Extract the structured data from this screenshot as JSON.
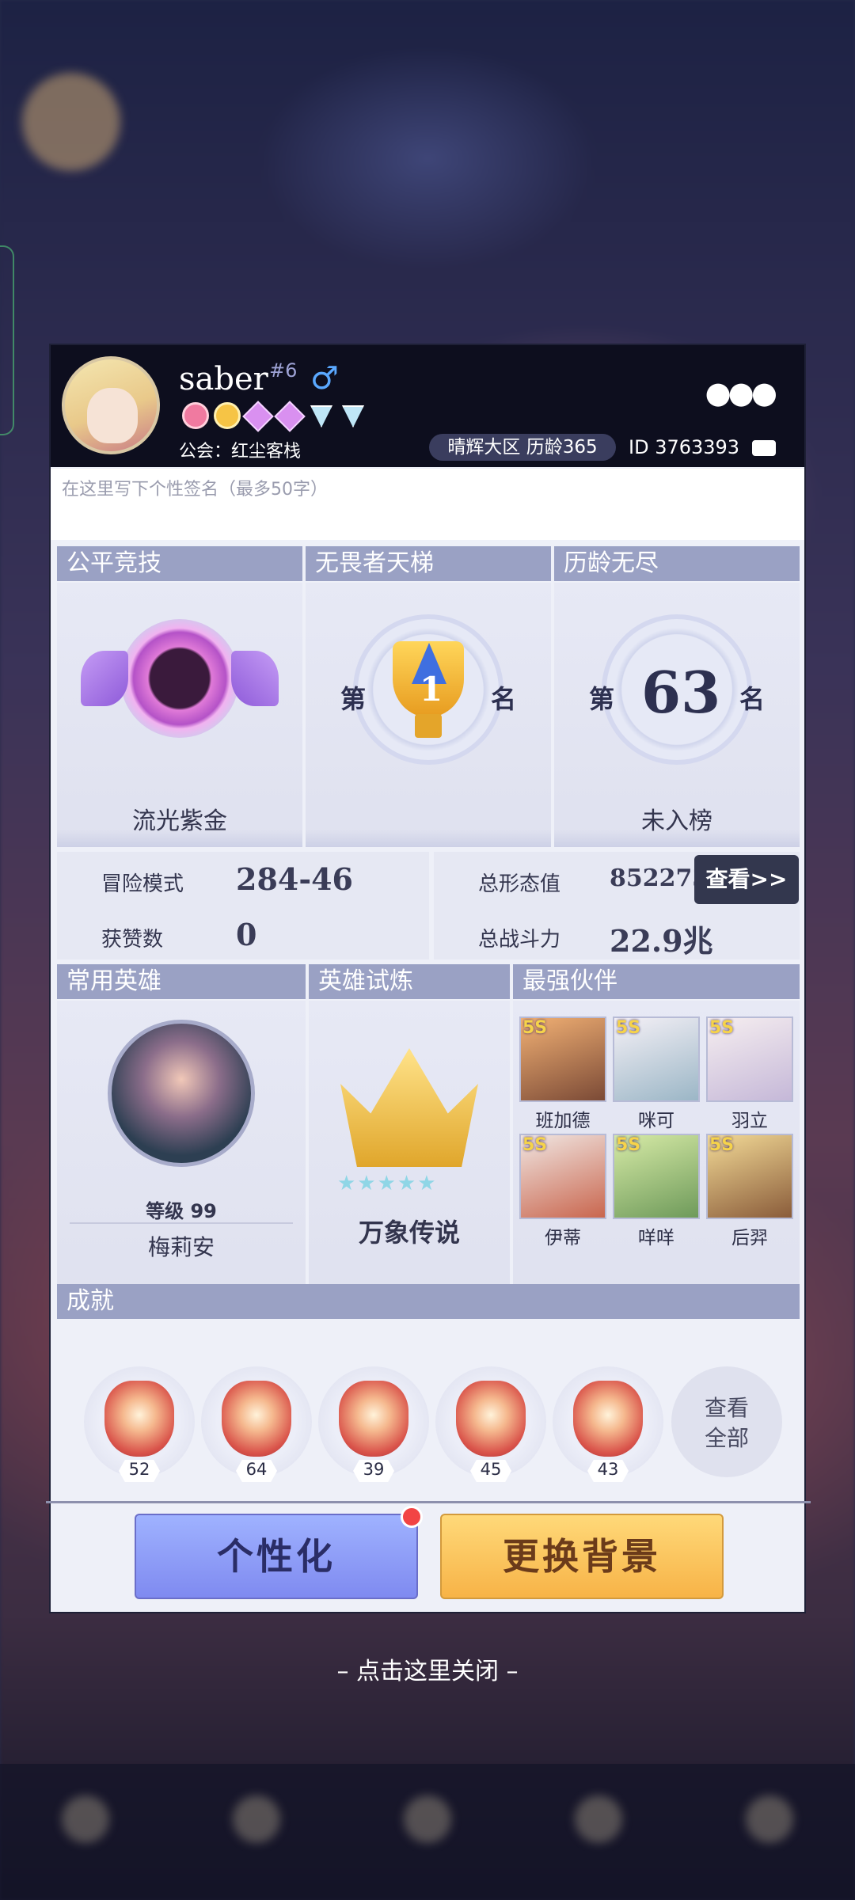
{
  "profile": {
    "name": "saber",
    "rank": "#6",
    "gender_symbol": "♂",
    "more": "●●●",
    "guild": "公会：红尘客栈",
    "zone": "晴辉大区  历龄365",
    "id": "ID 3763393",
    "signature_placeholder": "在这里写下个性签名（最多50字）"
  },
  "rankings": [
    {
      "title": "公平竞技",
      "label": "流光紫金"
    },
    {
      "title": "无畏者天梯",
      "prefix": "第",
      "place": "1",
      "suffix": "名"
    },
    {
      "title": "历龄无尽",
      "prefix": "第",
      "place": "63",
      "suffix": "名",
      "label": "未入榜"
    }
  ],
  "stats": {
    "adventure_label": "冒险模式",
    "adventure_value": "284-46",
    "likes_label": "获赞数",
    "likes_value": "0",
    "form_label": "总形态值",
    "form_value": "852273",
    "power_label": "总战斗力",
    "power_value": "22.9兆",
    "view_button": "查看>>"
  },
  "hero": {
    "title": "常用英雄",
    "level": "等级 99",
    "name": "梅莉安"
  },
  "trial": {
    "title": "英雄试炼",
    "name": "万象传说"
  },
  "partners": {
    "title": "最强伙伴",
    "tag": "5S",
    "items": [
      "班加德",
      "咪可",
      "羽立",
      "伊蒂",
      "咩咩",
      "后羿"
    ]
  },
  "achievements": {
    "title": "成就",
    "counts": [
      "52",
      "64",
      "39",
      "45",
      "43"
    ],
    "view_all": "查看\n全部"
  },
  "buttons": {
    "personalize": "个性化",
    "change_bg": "更换背景"
  },
  "close_hint": "– 点击这里关闭 –"
}
